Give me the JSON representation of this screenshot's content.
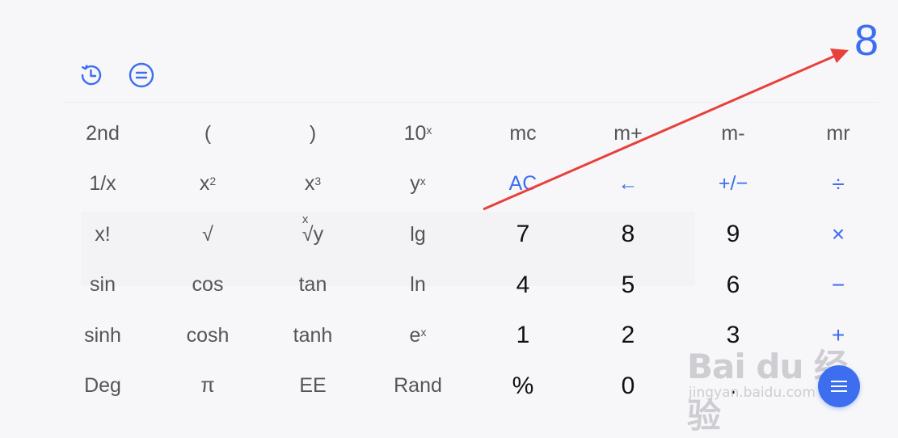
{
  "display": {
    "value": "8"
  },
  "icons": {
    "history": "clock-history-icon",
    "menu": "equals-menu-icon",
    "fab": "hamburger-menu-icon"
  },
  "keys": {
    "r1": [
      "2nd",
      "(",
      ")",
      "10",
      "mc",
      "m+",
      "m-",
      "mr"
    ],
    "r1_sup": "x",
    "r2": [
      "1/x",
      "x",
      "x",
      "y",
      "AC",
      "←",
      "+/−",
      "÷"
    ],
    "r2_sup": [
      "2",
      "3",
      "x"
    ],
    "r3": [
      "x!",
      "√",
      "√y",
      "lg",
      "7",
      "8",
      "9",
      "×"
    ],
    "r3_root_index": "x",
    "r4": [
      "sin",
      "cos",
      "tan",
      "ln",
      "4",
      "5",
      "6",
      "−"
    ],
    "r5": [
      "sinh",
      "cosh",
      "tanh",
      "e",
      "1",
      "2",
      "3",
      "+"
    ],
    "r5_sup": "x",
    "r6": [
      "Deg",
      "π",
      "EE",
      "Rand",
      "%",
      "0",
      ".",
      ""
    ]
  },
  "watermark": {
    "logo": "Bai du 经验",
    "url": "jingyan.baidu.com"
  },
  "colors": {
    "accent": "#3d6ef0",
    "annotation_arrow": "#e8403a",
    "background": "#f7f7f9"
  }
}
